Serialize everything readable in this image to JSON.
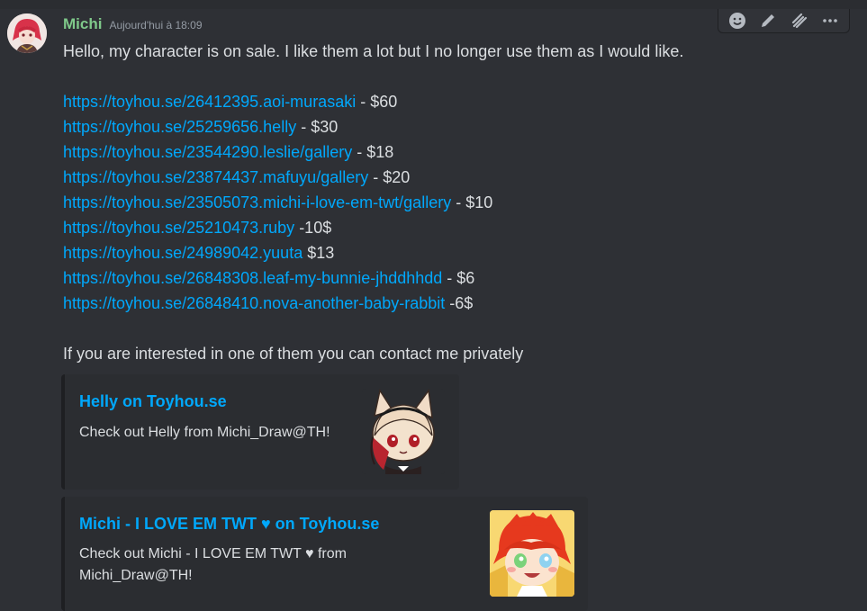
{
  "message": {
    "author": "Michi",
    "timestamp": "Aujourd'hui à 18:09",
    "intro": "Hello, my character is on sale. I like them a lot but I no longer use them as I would like.",
    "listings": [
      {
        "link": "https://toyhou.se/26412395.aoi-murasaki",
        "price": " - $60"
      },
      {
        "link": "https://toyhou.se/25259656.helly",
        "price": " - $30"
      },
      {
        "link": "https://toyhou.se/23544290.leslie/gallery",
        "price": " - $18"
      },
      {
        "link": "https://toyhou.se/23874437.mafuyu/gallery",
        "price": " - $20"
      },
      {
        "link": "https://toyhou.se/23505073.michi-i-love-em-twt/gallery",
        "price": " - $10"
      },
      {
        "link": "https://toyhou.se/25210473.ruby",
        "price": " -10$"
      },
      {
        "link": "https://toyhou.se/24989042.yuuta",
        "price": " $13"
      },
      {
        "link": "https://toyhou.se/26848308.leaf-my-bunnie-jhddhhdd",
        "price": " - $6"
      },
      {
        "link": "https://toyhou.se/26848410.nova-another-baby-rabbit",
        "price": " -6$"
      }
    ],
    "outro": "If you are interested in one of them you can contact me privately"
  },
  "embeds": [
    {
      "title": "Helly on Toyhou.se",
      "description": "Check out Helly from Michi_Draw@TH!"
    },
    {
      "title": "Michi - I LOVE EM TWT ♥ on Toyhou.se",
      "description": "Check out Michi - I LOVE EM TWT ♥ from Michi_Draw@TH!"
    }
  ],
  "toolbar": {
    "icons": [
      "add-reaction-icon",
      "edit-icon",
      "apps-icon",
      "more-icon"
    ]
  },
  "colors": {
    "username": "#7fc98a",
    "link": "#00a8fc",
    "background": "#2e3035"
  }
}
